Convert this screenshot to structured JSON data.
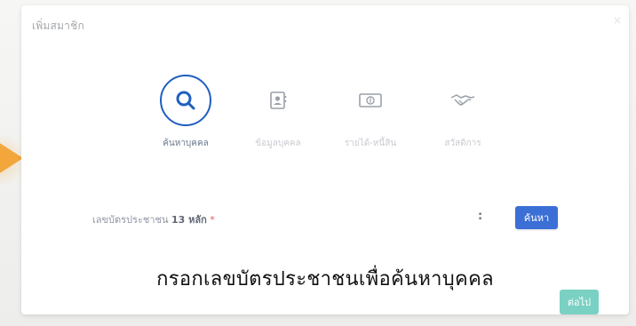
{
  "dialog": {
    "title": "เพิ่มสมาชิก",
    "close": "×"
  },
  "steps": [
    {
      "label": "ค้นหาบุคคล",
      "icon": "search-icon",
      "active": true
    },
    {
      "label": "ข้อมูลบุคคล",
      "icon": "contact-card-icon",
      "active": false
    },
    {
      "label": "รายได้-หนี้สิน",
      "icon": "banknote-icon",
      "active": false
    },
    {
      "label": "สวัสดิการ",
      "icon": "handshake-icon",
      "active": false
    }
  ],
  "form": {
    "id_label_prefix": "เลขบัตรประชาชน",
    "id_label_count": "13 หลัก",
    "required_mark": "*",
    "separator": ":",
    "search_button": "ค้นหา"
  },
  "caption": "กรอกเลขบัตรประชาชนเพื่อค้นหาบุคคล",
  "footer": {
    "next_button": "ต่อไป"
  },
  "colors": {
    "primary": "#1f5fbf",
    "button_blue": "#3b6fd6",
    "button_teal": "#7ad1c3",
    "pointer": "#f2a63b"
  }
}
